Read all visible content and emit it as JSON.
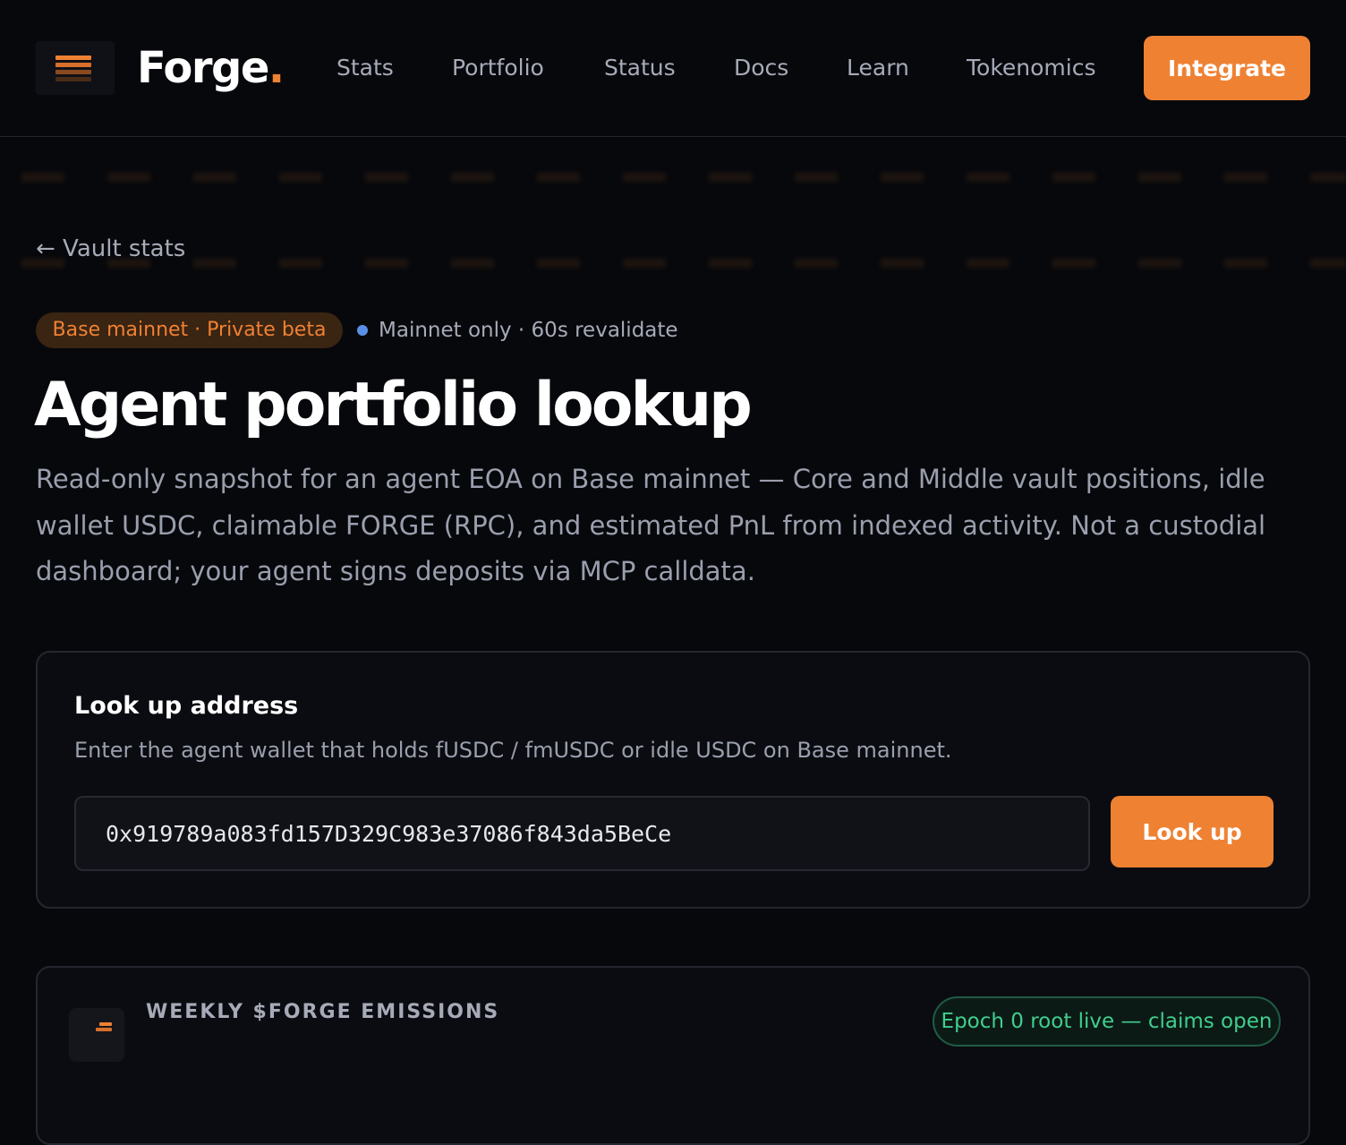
{
  "header": {
    "brand": "Forge",
    "brand_dot": ".",
    "nav": [
      "Stats",
      "Portfolio",
      "Status",
      "Docs",
      "Learn",
      "Tokenomics"
    ],
    "cta_label": "Integrate"
  },
  "breadcrumb": {
    "back_label": "← Vault stats"
  },
  "badges": {
    "network": "Base mainnet · Private beta",
    "status": "Mainnet only · 60s revalidate"
  },
  "hero": {
    "title": "Agent portfolio lookup",
    "description": "Read-only snapshot for an agent EOA on Base mainnet — Core and Middle vault positions, idle wallet USDC, claimable FORGE (RPC), and estimated PnL from indexed activity. Not a custodial dashboard; your agent signs deposits via MCP calldata."
  },
  "lookup": {
    "title": "Look up address",
    "subtitle": "Enter the agent wallet that holds fUSDC / fmUSDC or idle USDC on Base mainnet.",
    "address_value": "0x919789a083fd157D329C983e37086f843da5BeCe",
    "button_label": "Look up"
  },
  "emissions": {
    "label": "WEEKLY $FORGE EMISSIONS",
    "epoch_badge": "Epoch 0 root live — claims open"
  },
  "colors": {
    "accent": "#ef8133",
    "background": "#07080c",
    "card": "#0b0c11",
    "status_dot": "#5b8fe6",
    "success": "#3fcf8e"
  }
}
